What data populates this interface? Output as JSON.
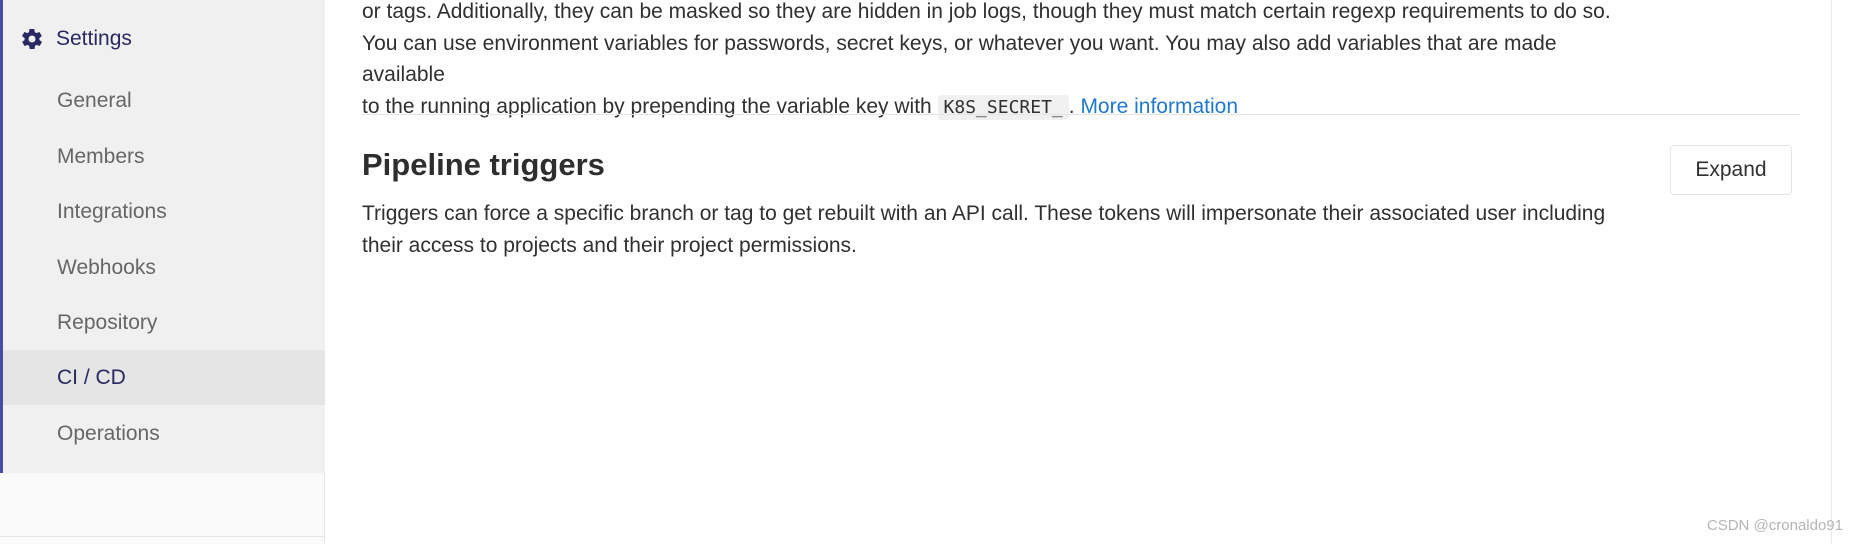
{
  "sidebar": {
    "header": {
      "label": "Settings",
      "icon": "gear-icon"
    },
    "items": [
      {
        "label": "General",
        "active": false
      },
      {
        "label": "Members",
        "active": false
      },
      {
        "label": "Integrations",
        "active": false
      },
      {
        "label": "Webhooks",
        "active": false
      },
      {
        "label": "Repository",
        "active": false
      },
      {
        "label": "CI / CD",
        "active": true
      },
      {
        "label": "Operations",
        "active": false
      }
    ]
  },
  "variables_section": {
    "line1": "or tags. Additionally, they can be masked so they are hidden in job logs, though they must match certain regexp requirements to do so.",
    "line2": "You can use environment variables for passwords, secret keys, or whatever you want. You may also add variables that are made available",
    "line3_prefix": "to the running application by prepending the variable key with ",
    "code": "K8S_SECRET_",
    "line3_suffix": ". ",
    "link": "More information"
  },
  "pipeline_triggers": {
    "title": "Pipeline triggers",
    "description": "Triggers can force a specific branch or tag to get rebuilt with an API call. These tokens will impersonate their associated user including their access to projects and their project permissions.",
    "expand_label": "Expand"
  },
  "watermark": "CSDN @cronaldo91",
  "colors": {
    "accent": "#4b4ba3",
    "link": "#1f78d1",
    "active_text": "#292961"
  }
}
